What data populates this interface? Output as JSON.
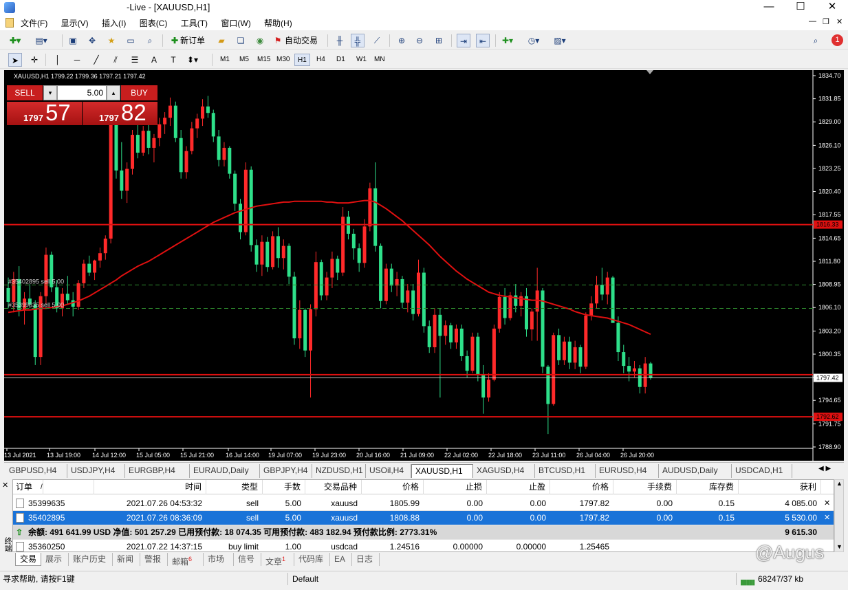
{
  "window": {
    "title": "-Live - [XAUUSD,H1]",
    "minimize": "—",
    "maximize": "☐",
    "close": "✕"
  },
  "menu": [
    "文件(F)",
    "显示(V)",
    "插入(I)",
    "图表(C)",
    "工具(T)",
    "窗口(W)",
    "帮助(H)"
  ],
  "toolbar": {
    "new_order": "新订单",
    "auto_trade": "自动交易",
    "notif_count": "1"
  },
  "timeframes": [
    "M1",
    "M5",
    "M15",
    "M30",
    "H1",
    "H4",
    "D1",
    "W1",
    "MN"
  ],
  "active_timeframe": "H1",
  "chart_info": "XAUUSD,H1  1799.22 1799.36 1797.21 1797.42",
  "oneclick": {
    "sell_label": "SELL",
    "buy_label": "BUY",
    "volume": "5.00",
    "sell_small": "1797",
    "sell_big": "57",
    "buy_small": "1797",
    "buy_big": "82"
  },
  "chart_data": {
    "type": "candlestick",
    "symbol": "XAUUSD",
    "timeframe": "H1",
    "y_ticks": [
      "1834.70",
      "1831.85",
      "1829.00",
      "1826.10",
      "1823.25",
      "1820.40",
      "1817.55",
      "1814.65",
      "1811.80",
      "1808.95",
      "1806.10",
      "1803.20",
      "1800.35",
      "1797.50",
      "1794.65",
      "1791.75",
      "1788.90"
    ],
    "x_ticks": [
      "13 Jul 2021",
      "13 Jul 19:00",
      "14 Jul 12:00",
      "15 Jul 05:00",
      "15 Jul 21:00",
      "16 Jul 14:00",
      "19 Jul 07:00",
      "19 Jul 23:00",
      "20 Jul 16:00",
      "21 Jul 09:00",
      "22 Jul 02:00",
      "22 Jul 18:00",
      "23 Jul 11:00",
      "26 Jul 04:00",
      "26 Jul 20:00"
    ],
    "ylim": [
      1788.9,
      1834.7
    ],
    "price_labels": [
      {
        "price": 1816.33,
        "text": "1816.33",
        "color": "#e01010"
      },
      {
        "price": 1797.42,
        "text": "1797.42",
        "color": "#ffffff"
      },
      {
        "price": 1792.62,
        "text": "1792.62",
        "color": "#e01010"
      }
    ],
    "hlines": [
      {
        "price": 1816.33,
        "color": "#e01010",
        "style": "solid"
      },
      {
        "price": 1808.88,
        "color": "#2e8b2e",
        "style": "dash",
        "label": "#35402895 sell 5.00"
      },
      {
        "price": 1805.99,
        "color": "#2e8b2e",
        "style": "dash",
        "label": "#35399635 sell 5.00"
      },
      {
        "price": 1797.82,
        "color": "#e01010",
        "style": "solid"
      },
      {
        "price": 1797.42,
        "color": "#c0c0c0",
        "style": "solid"
      },
      {
        "price": 1792.62,
        "color": "#e01010",
        "style": "solid"
      }
    ],
    "candles": [
      [
        1808.5,
        1809.8,
        1806.0,
        1806.8
      ],
      [
        1806.8,
        1810.5,
        1805.5,
        1809.6
      ],
      [
        1809.6,
        1811.2,
        1805.0,
        1805.8
      ],
      [
        1805.8,
        1808.0,
        1804.0,
        1807.2
      ],
      [
        1807.2,
        1809.0,
        1806.0,
        1806.5
      ],
      [
        1806.5,
        1807.0,
        1799.0,
        1800.0
      ],
      [
        1800.0,
        1808.0,
        1799.0,
        1807.5
      ],
      [
        1807.5,
        1813.5,
        1806.5,
        1812.6
      ],
      [
        1812.6,
        1813.0,
        1808.0,
        1808.6
      ],
      [
        1808.6,
        1809.5,
        1805.5,
        1806.0
      ],
      [
        1806.0,
        1808.5,
        1805.0,
        1807.8
      ],
      [
        1807.8,
        1810.0,
        1806.5,
        1807.0
      ],
      [
        1807.0,
        1808.0,
        1805.0,
        1806.2
      ],
      [
        1806.2,
        1809.5,
        1805.8,
        1809.1
      ],
      [
        1809.1,
        1812.0,
        1808.5,
        1811.5
      ],
      [
        1811.5,
        1812.5,
        1810.0,
        1810.4
      ],
      [
        1810.4,
        1812.0,
        1809.5,
        1811.9
      ],
      [
        1811.9,
        1813.5,
        1811.0,
        1812.8
      ],
      [
        1812.8,
        1815.0,
        1812.0,
        1814.6
      ],
      [
        1814.6,
        1830.0,
        1814.0,
        1829.0
      ],
      [
        1829.0,
        1830.5,
        1822.0,
        1823.0
      ],
      [
        1823.0,
        1826.5,
        1819.5,
        1820.5
      ],
      [
        1820.5,
        1824.0,
        1819.0,
        1823.2
      ],
      [
        1823.2,
        1828.0,
        1822.5,
        1827.4
      ],
      [
        1827.4,
        1829.0,
        1824.5,
        1825.2
      ],
      [
        1825.2,
        1828.5,
        1824.8,
        1827.9
      ],
      [
        1827.9,
        1829.0,
        1825.0,
        1825.8
      ],
      [
        1825.8,
        1827.5,
        1824.0,
        1827.0
      ],
      [
        1827.0,
        1829.5,
        1826.0,
        1828.7
      ],
      [
        1828.7,
        1830.2,
        1827.5,
        1829.5
      ],
      [
        1829.5,
        1832.0,
        1828.5,
        1831.0
      ],
      [
        1831.0,
        1831.5,
        1826.5,
        1827.0
      ],
      [
        1827.0,
        1828.0,
        1822.0,
        1822.8
      ],
      [
        1822.8,
        1826.0,
        1822.0,
        1825.4
      ],
      [
        1825.4,
        1829.0,
        1825.0,
        1828.2
      ],
      [
        1828.2,
        1830.0,
        1827.0,
        1829.4
      ],
      [
        1829.4,
        1831.8,
        1828.5,
        1830.9
      ],
      [
        1830.9,
        1832.2,
        1829.5,
        1830.1
      ],
      [
        1830.1,
        1830.5,
        1826.5,
        1827.2
      ],
      [
        1827.2,
        1828.0,
        1823.5,
        1824.3
      ],
      [
        1824.3,
        1826.5,
        1823.5,
        1825.8
      ],
      [
        1825.8,
        1826.0,
        1822.0,
        1822.6
      ],
      [
        1822.6,
        1823.0,
        1818.0,
        1818.9
      ],
      [
        1818.9,
        1819.5,
        1814.5,
        1815.4
      ],
      [
        1815.4,
        1824.0,
        1815.0,
        1823.1
      ],
      [
        1823.1,
        1823.5,
        1813.0,
        1813.8
      ],
      [
        1813.8,
        1814.5,
        1810.5,
        1811.4
      ],
      [
        1811.4,
        1815.0,
        1810.0,
        1814.2
      ],
      [
        1814.2,
        1814.8,
        1810.5,
        1811.1
      ],
      [
        1811.1,
        1815.5,
        1810.8,
        1814.9
      ],
      [
        1814.9,
        1816.0,
        1811.0,
        1812.2
      ],
      [
        1812.2,
        1814.5,
        1810.8,
        1813.7
      ],
      [
        1813.7,
        1814.0,
        1809.0,
        1809.9
      ],
      [
        1809.9,
        1810.5,
        1801.5,
        1802.3
      ],
      [
        1802.3,
        1807.0,
        1801.0,
        1805.8
      ],
      [
        1805.8,
        1806.0,
        1800.0,
        1800.8
      ],
      [
        1800.8,
        1806.5,
        1795.0,
        1805.9
      ],
      [
        1805.9,
        1813.0,
        1805.0,
        1811.7
      ],
      [
        1811.7,
        1812.0,
        1807.0,
        1807.6
      ],
      [
        1807.6,
        1810.5,
        1807.0,
        1809.8
      ],
      [
        1809.8,
        1813.0,
        1808.5,
        1812.1
      ],
      [
        1812.1,
        1812.5,
        1809.5,
        1810.4
      ],
      [
        1810.4,
        1818.5,
        1810.0,
        1817.3
      ],
      [
        1817.3,
        1818.0,
        1814.5,
        1815.2
      ],
      [
        1815.2,
        1815.8,
        1812.0,
        1813.4
      ],
      [
        1813.4,
        1814.0,
        1810.5,
        1811.6
      ],
      [
        1811.6,
        1817.0,
        1811.0,
        1816.1
      ],
      [
        1816.1,
        1821.5,
        1815.5,
        1820.8
      ],
      [
        1820.8,
        1824.0,
        1813.0,
        1813.7
      ],
      [
        1813.7,
        1814.0,
        1806.0,
        1806.9
      ],
      [
        1806.9,
        1811.5,
        1806.5,
        1810.9
      ],
      [
        1810.9,
        1811.5,
        1808.0,
        1808.8
      ],
      [
        1808.8,
        1810.5,
        1807.5,
        1809.6
      ],
      [
        1809.6,
        1810.0,
        1806.0,
        1806.7
      ],
      [
        1806.7,
        1809.0,
        1805.5,
        1808.2
      ],
      [
        1808.2,
        1809.0,
        1804.5,
        1805.3
      ],
      [
        1805.3,
        1812.0,
        1805.0,
        1810.4
      ],
      [
        1810.4,
        1811.0,
        1803.0,
        1803.8
      ],
      [
        1803.8,
        1804.5,
        1800.5,
        1801.2
      ],
      [
        1801.2,
        1806.0,
        1800.5,
        1805.2
      ],
      [
        1805.2,
        1806.0,
        1795.0,
        1802.6
      ],
      [
        1802.6,
        1804.5,
        1801.5,
        1803.9
      ],
      [
        1803.9,
        1804.2,
        1801.0,
        1801.8
      ],
      [
        1801.8,
        1804.0,
        1801.0,
        1803.5
      ],
      [
        1803.5,
        1804.0,
        1799.5,
        1800.1
      ],
      [
        1800.1,
        1800.8,
        1797.5,
        1798.3
      ],
      [
        1798.3,
        1803.0,
        1798.0,
        1802.5
      ],
      [
        1802.5,
        1803.0,
        1797.0,
        1797.8
      ],
      [
        1797.8,
        1799.0,
        1793.0,
        1795.0
      ],
      [
        1795.0,
        1798.0,
        1794.5,
        1797.2
      ],
      [
        1797.2,
        1804.0,
        1797.0,
        1803.5
      ],
      [
        1803.5,
        1808.0,
        1803.0,
        1807.4
      ],
      [
        1807.4,
        1808.5,
        1804.0,
        1804.8
      ],
      [
        1804.8,
        1808.0,
        1804.5,
        1807.6
      ],
      [
        1807.6,
        1809.0,
        1805.5,
        1806.3
      ],
      [
        1806.3,
        1808.0,
        1805.0,
        1807.5
      ],
      [
        1807.5,
        1808.5,
        1802.5,
        1803.4
      ],
      [
        1803.4,
        1806.0,
        1802.0,
        1805.6
      ],
      [
        1805.6,
        1811.0,
        1802.0,
        1808.2
      ],
      [
        1808.2,
        1808.5,
        1798.0,
        1798.8
      ],
      [
        1798.8,
        1799.0,
        1790.5,
        1794.2
      ],
      [
        1794.2,
        1803.0,
        1794.0,
        1802.7
      ],
      [
        1802.7,
        1803.5,
        1799.0,
        1799.6
      ],
      [
        1799.6,
        1802.5,
        1799.0,
        1801.9
      ],
      [
        1801.9,
        1802.5,
        1798.5,
        1799.3
      ],
      [
        1799.3,
        1802.0,
        1798.5,
        1801.2
      ],
      [
        1801.2,
        1801.5,
        1798.0,
        1798.8
      ],
      [
        1798.8,
        1805.5,
        1798.5,
        1805.1
      ],
      [
        1805.1,
        1807.5,
        1804.5,
        1806.6
      ],
      [
        1806.6,
        1810.0,
        1806.0,
        1808.9
      ],
      [
        1808.9,
        1811.0,
        1807.0,
        1807.7
      ],
      [
        1807.7,
        1810.5,
        1806.5,
        1809.8
      ],
      [
        1809.8,
        1810.0,
        1806.0,
        1804.2
      ],
      [
        1804.2,
        1805.0,
        1799.5,
        1800.6
      ],
      [
        1800.6,
        1801.5,
        1798.0,
        1798.9
      ],
      [
        1798.9,
        1800.0,
        1797.0,
        1798.2
      ],
      [
        1798.2,
        1799.5,
        1797.5,
        1798.6
      ],
      [
        1798.6,
        1799.0,
        1795.5,
        1796.3
      ],
      [
        1796.3,
        1800.0,
        1795.5,
        1799.2
      ],
      [
        1799.2,
        1799.4,
        1797.2,
        1797.4
      ]
    ],
    "ma": [
      1805.5,
      1805.6,
      1805.7,
      1805.8,
      1805.8,
      1805.9,
      1806.0,
      1806.0,
      1806.1,
      1806.2,
      1806.3,
      1806.5,
      1806.7,
      1806.9,
      1807.2,
      1807.5,
      1807.9,
      1808.3,
      1808.7,
      1809.1,
      1809.5,
      1810.0,
      1810.4,
      1810.8,
      1811.2,
      1811.5,
      1811.8,
      1812.2,
      1812.6,
      1813.0,
      1813.4,
      1813.8,
      1814.2,
      1814.6,
      1815.0,
      1815.4,
      1815.8,
      1816.2,
      1816.6,
      1816.9,
      1817.2,
      1817.5,
      1817.8,
      1818.0,
      1818.2,
      1818.4,
      1818.6,
      1818.7,
      1818.8,
      1818.9,
      1819.0,
      1819.1,
      1819.1,
      1819.2,
      1819.2,
      1819.2,
      1819.2,
      1819.2,
      1819.2,
      1819.1,
      1819.1,
      1819.0,
      1819.0,
      1819.0,
      1819.1,
      1819.2,
      1819.3,
      1819.3,
      1819.1,
      1818.7,
      1818.3,
      1817.8,
      1817.3,
      1816.8,
      1816.2,
      1815.6,
      1815.0,
      1814.4,
      1813.8,
      1813.1,
      1812.4,
      1811.8,
      1811.2,
      1810.6,
      1810.1,
      1809.6,
      1809.2,
      1808.8,
      1808.4,
      1808.0,
      1807.8,
      1807.6,
      1807.5,
      1807.4,
      1807.3,
      1807.2,
      1807.1,
      1807.0,
      1807.0,
      1806.9,
      1806.7,
      1806.5,
      1806.3,
      1806.1,
      1805.9,
      1805.6,
      1805.4,
      1805.2,
      1805.1,
      1805.0,
      1804.9,
      1804.8,
      1804.6,
      1804.4,
      1804.2,
      1804.0,
      1803.7,
      1803.4,
      1803.1,
      1802.8
    ]
  },
  "symbol_tabs": [
    "GBPUSD,H4",
    "USDJPY,H4",
    "EURGBP,H4",
    "EURAUD,Daily",
    "GBPJPY,H4",
    "NZDUSD,H1",
    "USOil,H4",
    "XAUUSD,H1",
    "XAGUSD,H4",
    "BTCUSD,H1",
    "EURUSD,H4",
    "AUDUSD,Daily",
    "USDCAD,H1"
  ],
  "active_symbol_tab": "XAUUSD,H1",
  "terminal": {
    "headers": [
      "订单",
      "时间",
      "类型",
      "手数",
      "交易品种",
      "价格",
      "止损",
      "止盈",
      "价格",
      "手续费",
      "库存费",
      "获利"
    ],
    "sort_marker": "/",
    "rows": [
      [
        "35399635",
        "2021.07.26 04:53:32",
        "sell",
        "5.00",
        "xauusd",
        "1805.99",
        "0.00",
        "0.00",
        "1797.82",
        "0.00",
        "0.15",
        "4 085.00"
      ],
      [
        "35402895",
        "2021.07.26 08:36:09",
        "sell",
        "5.00",
        "xauusd",
        "1808.88",
        "0.00",
        "0.00",
        "1797.82",
        "0.00",
        "0.15",
        "5 530.00"
      ]
    ],
    "balance_line": "余额: 491 641.99 USD  净值: 501 257.29  已用预付款: 18 074.35  可用预付款: 483 182.94  预付款比例: 2773.31%",
    "balance_profit": "9 615.30",
    "pending_row": [
      "35360250",
      "2021.07.22 14:37:15",
      "buy limit",
      "1.00",
      "usdcad",
      "1.24516",
      "0.00000",
      "0.00000",
      "1.25465"
    ],
    "side_label": "终端"
  },
  "terminal_tabs": [
    "交易",
    "展示",
    "账户历史",
    "新闻",
    "警报",
    "邮箱",
    "市场",
    "信号",
    "文章",
    "代码库",
    "EA",
    "日志"
  ],
  "mailbox_badge": "6",
  "articles_badge": "1",
  "watermark": "@Augus",
  "status": {
    "help": "寻求帮助, 请按F1键",
    "profile": "Default",
    "traffic": "68247/37 kb"
  }
}
